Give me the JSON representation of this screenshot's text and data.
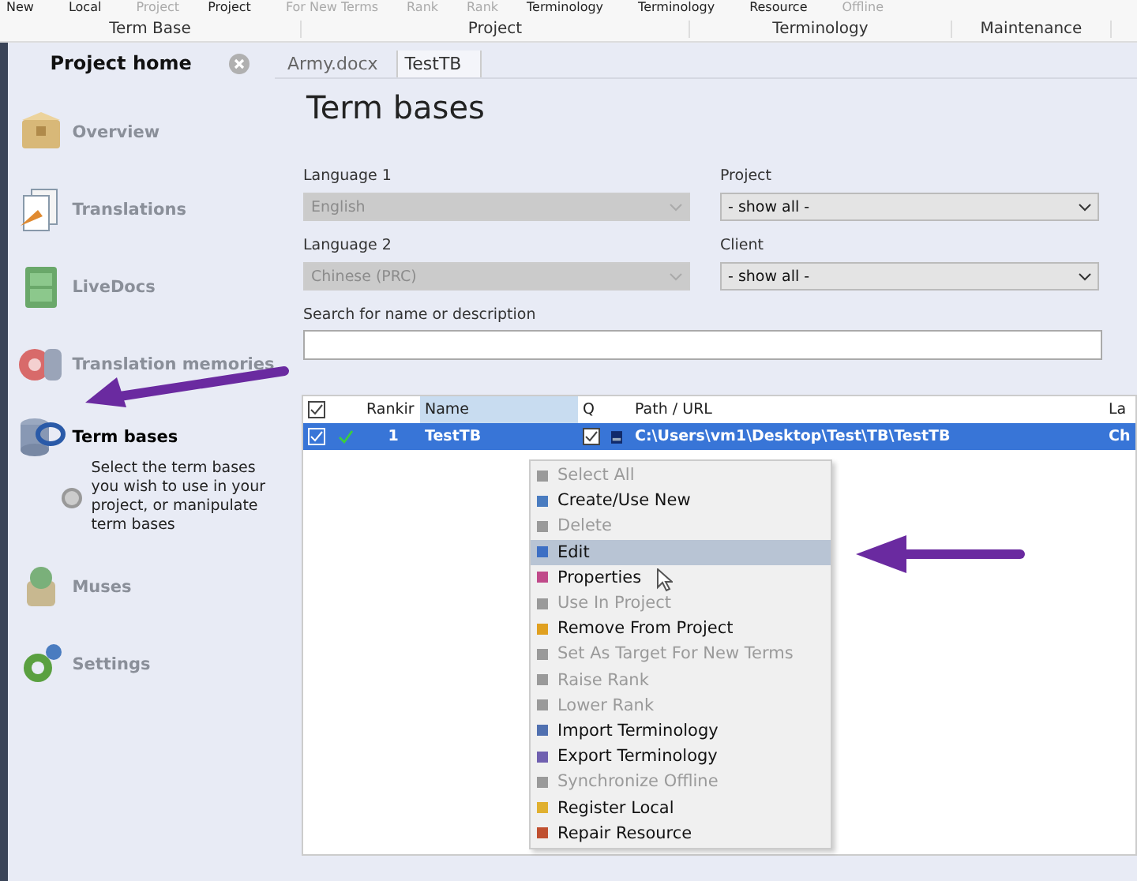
{
  "ribbon": {
    "commands": [
      {
        "label": "New",
        "disabled": false
      },
      {
        "label": "Local",
        "disabled": false
      },
      {
        "label": "Project",
        "disabled": true
      },
      {
        "label": "Project",
        "disabled": false
      },
      {
        "label": "For New Terms",
        "disabled": true
      },
      {
        "label": "Rank",
        "disabled": true
      },
      {
        "label": "Rank",
        "disabled": true
      },
      {
        "label": "Terminology",
        "disabled": false
      },
      {
        "label": "Terminology",
        "disabled": false
      },
      {
        "label": "Resource",
        "disabled": false
      },
      {
        "label": "Offline",
        "disabled": true
      }
    ],
    "groups": [
      "Term Base",
      "Project",
      "Terminology",
      "Maintenance"
    ]
  },
  "sidebar": {
    "title": "Project home",
    "items": [
      {
        "kind": "box",
        "label": "Overview",
        "selected": false
      },
      {
        "kind": "docs",
        "label": "Translations",
        "selected": false
      },
      {
        "kind": "cabinet",
        "label": "LiveDocs",
        "selected": false
      },
      {
        "kind": "disc",
        "label": "Translation memories",
        "selected": false
      },
      {
        "kind": "db",
        "label": "Term bases",
        "selected": true,
        "description": "Select the term bases you wish to use in your project, or manipulate term bases"
      },
      {
        "kind": "muses",
        "label": "Muses",
        "selected": false
      },
      {
        "kind": "gear",
        "label": "Settings",
        "selected": false
      }
    ]
  },
  "tabs": [
    {
      "label": "Army.docx",
      "selected": false
    },
    {
      "label": "TestTB",
      "selected": true
    }
  ],
  "page_title": "Term bases",
  "filters": [
    {
      "label": "Language 1",
      "value": "English",
      "disabled": true
    },
    {
      "label": "Project",
      "value": "- show all -",
      "disabled": false
    },
    {
      "label": "Language 2",
      "value": "Chinese (PRC)",
      "disabled": true
    },
    {
      "label": "Client",
      "value": "- show all -",
      "disabled": false
    }
  ],
  "search": {
    "label": "Search for name or description"
  },
  "table": {
    "header_checked": true,
    "columns": [
      "Rankir",
      "Name",
      "Q",
      "Path / URL",
      "La"
    ],
    "rows": [
      {
        "checked": true,
        "used": true,
        "rank": "1",
        "name": "TestTB",
        "q_checked": true,
        "path": "C:\\Users\\vm1\\Desktop\\Test\\TB\\TestTB",
        "column_5": "Ch",
        "selected": true
      }
    ]
  },
  "context_menu": [
    {
      "label": "Select All",
      "disabled": true,
      "selected": false,
      "color": "#9a9a9a"
    },
    {
      "label": "Create/Use New",
      "disabled": false,
      "selected": false,
      "color": "#4a7cc0"
    },
    {
      "label": "Delete",
      "disabled": true,
      "selected": false,
      "color": "#9a9a9a"
    },
    {
      "label": "Edit",
      "disabled": false,
      "selected": true,
      "color": "#3d6fc4"
    },
    {
      "label": "Properties",
      "disabled": false,
      "selected": false,
      "color": "#c04a8a"
    },
    {
      "label": "Use In Project",
      "disabled": true,
      "selected": false,
      "color": "#9a9a9a"
    },
    {
      "label": "Remove From Project",
      "disabled": false,
      "selected": false,
      "color": "#e0a020"
    },
    {
      "label": "Set As Target For New Terms",
      "disabled": true,
      "selected": false,
      "color": "#9a9a9a"
    },
    {
      "label": "Raise Rank",
      "disabled": true,
      "selected": false,
      "color": "#9a9a9a"
    },
    {
      "label": "Lower Rank",
      "disabled": true,
      "selected": false,
      "color": "#9a9a9a"
    },
    {
      "label": "Import Terminology",
      "disabled": false,
      "selected": false,
      "color": "#5070b0"
    },
    {
      "label": "Export Terminology",
      "disabled": false,
      "selected": false,
      "color": "#7060b0"
    },
    {
      "label": "Synchronize Offline",
      "disabled": true,
      "selected": false,
      "color": "#9a9a9a"
    },
    {
      "label": "Register Local",
      "disabled": false,
      "selected": false,
      "color": "#e0b030"
    },
    {
      "label": "Repair Resource",
      "disabled": false,
      "selected": false,
      "color": "#c05030"
    }
  ]
}
